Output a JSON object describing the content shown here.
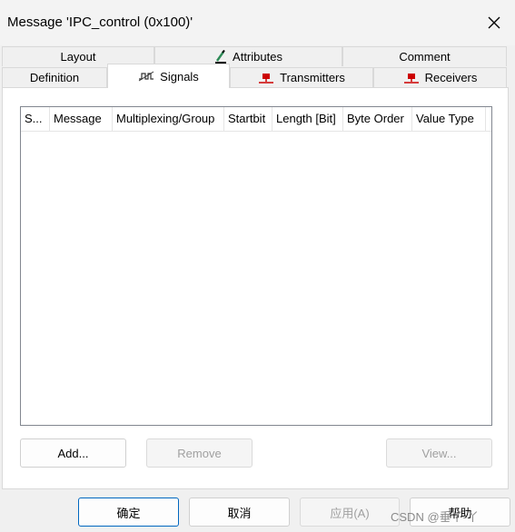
{
  "window": {
    "title": "Message 'IPC_control (0x100)'",
    "close_icon": "close-x-icon"
  },
  "tabs": {
    "row1": [
      {
        "label": "Layout",
        "icon": ""
      },
      {
        "label": "Attributes",
        "icon": "attributes-pencil-icon"
      },
      {
        "label": "Comment",
        "icon": ""
      }
    ],
    "row2": [
      {
        "label": "Definition",
        "icon": ""
      },
      {
        "label": "Signals",
        "icon": "signal-wave-icon",
        "active": true
      },
      {
        "label": "Transmitters",
        "icon": "node-red-icon"
      },
      {
        "label": "Receivers",
        "icon": "node-red-icon"
      }
    ]
  },
  "signals_list": {
    "columns": [
      "S...",
      "Message",
      "Multiplexing/Group",
      "Startbit",
      "Length [Bit]",
      "Byte Order",
      "Value Type"
    ],
    "rows": []
  },
  "list_buttons": {
    "add": "Add...",
    "remove": "Remove",
    "view": "View..."
  },
  "dialog_buttons": {
    "ok": "确定",
    "cancel": "取消",
    "apply": "应用(A)",
    "help": "帮助"
  },
  "watermark": "CSDN @垂丫-丫",
  "colors": {
    "accent": "#0067c0",
    "icon_red": "#cc0000",
    "icon_green": "#2e8b57"
  }
}
